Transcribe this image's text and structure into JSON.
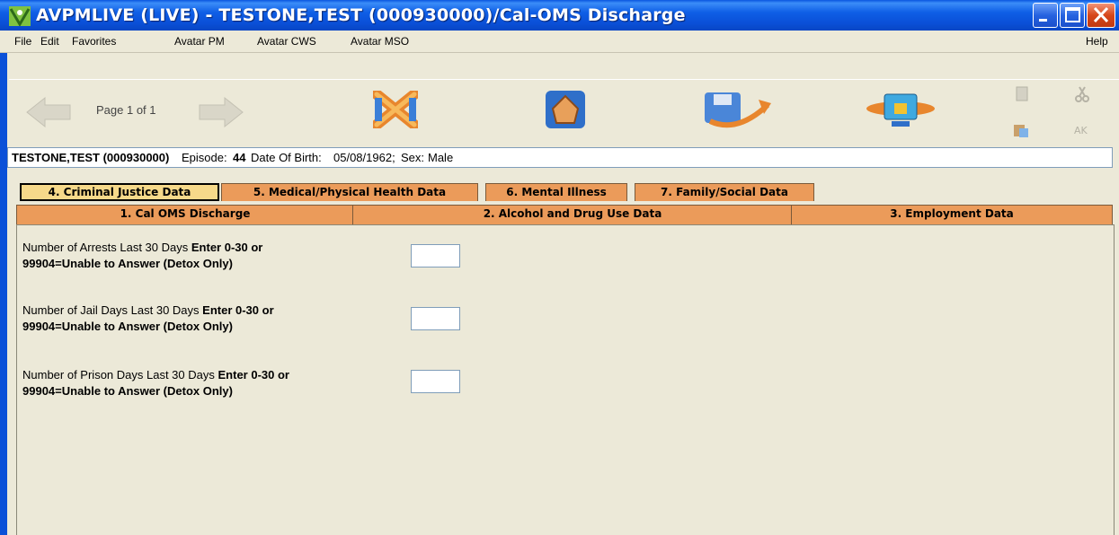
{
  "window": {
    "title": "AVPMLIVE (LIVE) - TESTONE,TEST (000930000)/Cal-OMS Discharge"
  },
  "menu": {
    "file": "File",
    "edit": "Edit",
    "favorites": "Favorites",
    "avatar_pm": "Avatar PM",
    "avatar_cws": "Avatar CWS",
    "avatar_mso": "Avatar MSO",
    "help": "Help"
  },
  "toolbar": {
    "page_label": "Page 1 of 1",
    "icons": [
      "back-arrow-icon",
      "cancel-x-icon",
      "home-icon",
      "submit-icon",
      "lock-icon",
      "copy-icon",
      "cut-icon",
      "paste-icon",
      "spellcheck-icon"
    ]
  },
  "patient": {
    "name_id": "TESTONE,TEST (000930000)",
    "episode_label": "Episode:",
    "episode": "44",
    "dob_label": "Date Of Birth:",
    "dob": "05/08/1962;",
    "sex_label": "Sex:",
    "sex": "Male"
  },
  "tabs_row1": [
    {
      "label": "4. Criminal Justice Data",
      "active": true
    },
    {
      "label": "5. Medical/Physical Health Data",
      "active": false
    },
    {
      "label": "6. Mental Illness",
      "active": false
    },
    {
      "label": "7. Family/Social Data",
      "active": false
    }
  ],
  "tabs_row2": [
    {
      "label": "1. Cal OMS Discharge"
    },
    {
      "label": "2. Alcohol and Drug Use Data"
    },
    {
      "label": "3. Employment Data"
    }
  ],
  "questions": [
    {
      "label": "Number of Arrests Last 30 Days",
      "hint1": "Enter 0-30 or",
      "hint2": "99904=Unable to Answer (Detox Only)",
      "value": ""
    },
    {
      "label": "Number of Jail Days Last 30 Days",
      "hint1": "Enter 0-30 or",
      "hint2": "99904=Unable to Answer (Detox Only)",
      "value": ""
    },
    {
      "label": "Number of Prison Days Last 30 Days",
      "hint1": "Enter 0-30 or",
      "hint2": "99904=Unable to Answer (Detox Only)",
      "value": ""
    }
  ],
  "colors": {
    "titlebar": "#0A50D8",
    "tab": "#EB9B5A",
    "tab_active": "#F6D98A",
    "background": "#ECE9D8"
  }
}
